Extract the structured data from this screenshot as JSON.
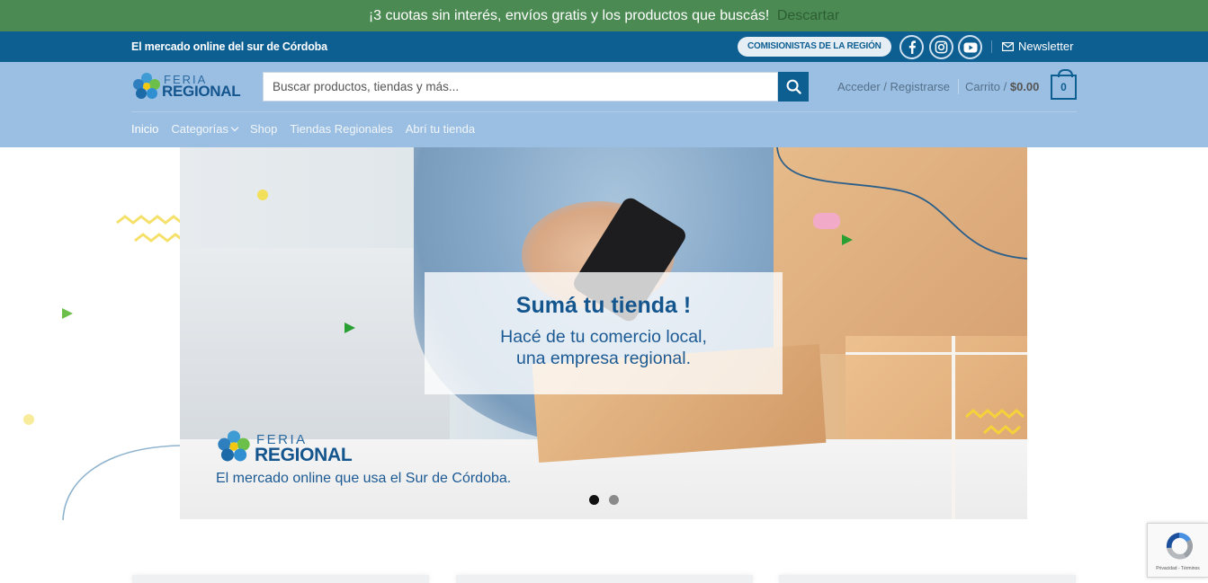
{
  "promo": {
    "text": "¡3 cuotas sin interés, envíos gratis y los productos que buscás!",
    "dismiss": "Descartar"
  },
  "topbar": {
    "tagline": "El mercado online del sur de Córdoba",
    "pill": "COMISIONISTAS DE LA REGIÓN",
    "social_icons": [
      "facebook-icon",
      "instagram-icon",
      "youtube-icon"
    ],
    "newsletter": "Newsletter"
  },
  "header": {
    "logo": {
      "line1": "FERIA",
      "line2": "REGIONAL"
    },
    "search_placeholder": "Buscar productos, tiendas y más...",
    "account": "Acceder / Registrarse",
    "cart_label": "Carrito / ",
    "cart_total": "$0.00",
    "cart_count": "0",
    "nav": [
      {
        "label": "Inicio"
      },
      {
        "label": "Categorías"
      },
      {
        "label": "Shop"
      },
      {
        "label": "Tiendas Regionales"
      },
      {
        "label": "Abrí tu tienda"
      }
    ]
  },
  "slider": {
    "heading": "Sumá tu tienda !",
    "line1": "Hacé de tu comercio local,",
    "line2": "una empresa regional.",
    "logo": {
      "line1": "FERIA",
      "line2": "REGIONAL"
    },
    "tagline": "El mercado online que usa el Sur de Córdoba.",
    "slides": 2,
    "active_slide": 1
  },
  "recaptcha": {
    "text": "Privacidad - Términos"
  },
  "colors": {
    "promo_bg": "#4b8a52",
    "topbar_bg": "#0d5e91",
    "header_bg": "#9bbfe3",
    "accent": "#14558e"
  }
}
